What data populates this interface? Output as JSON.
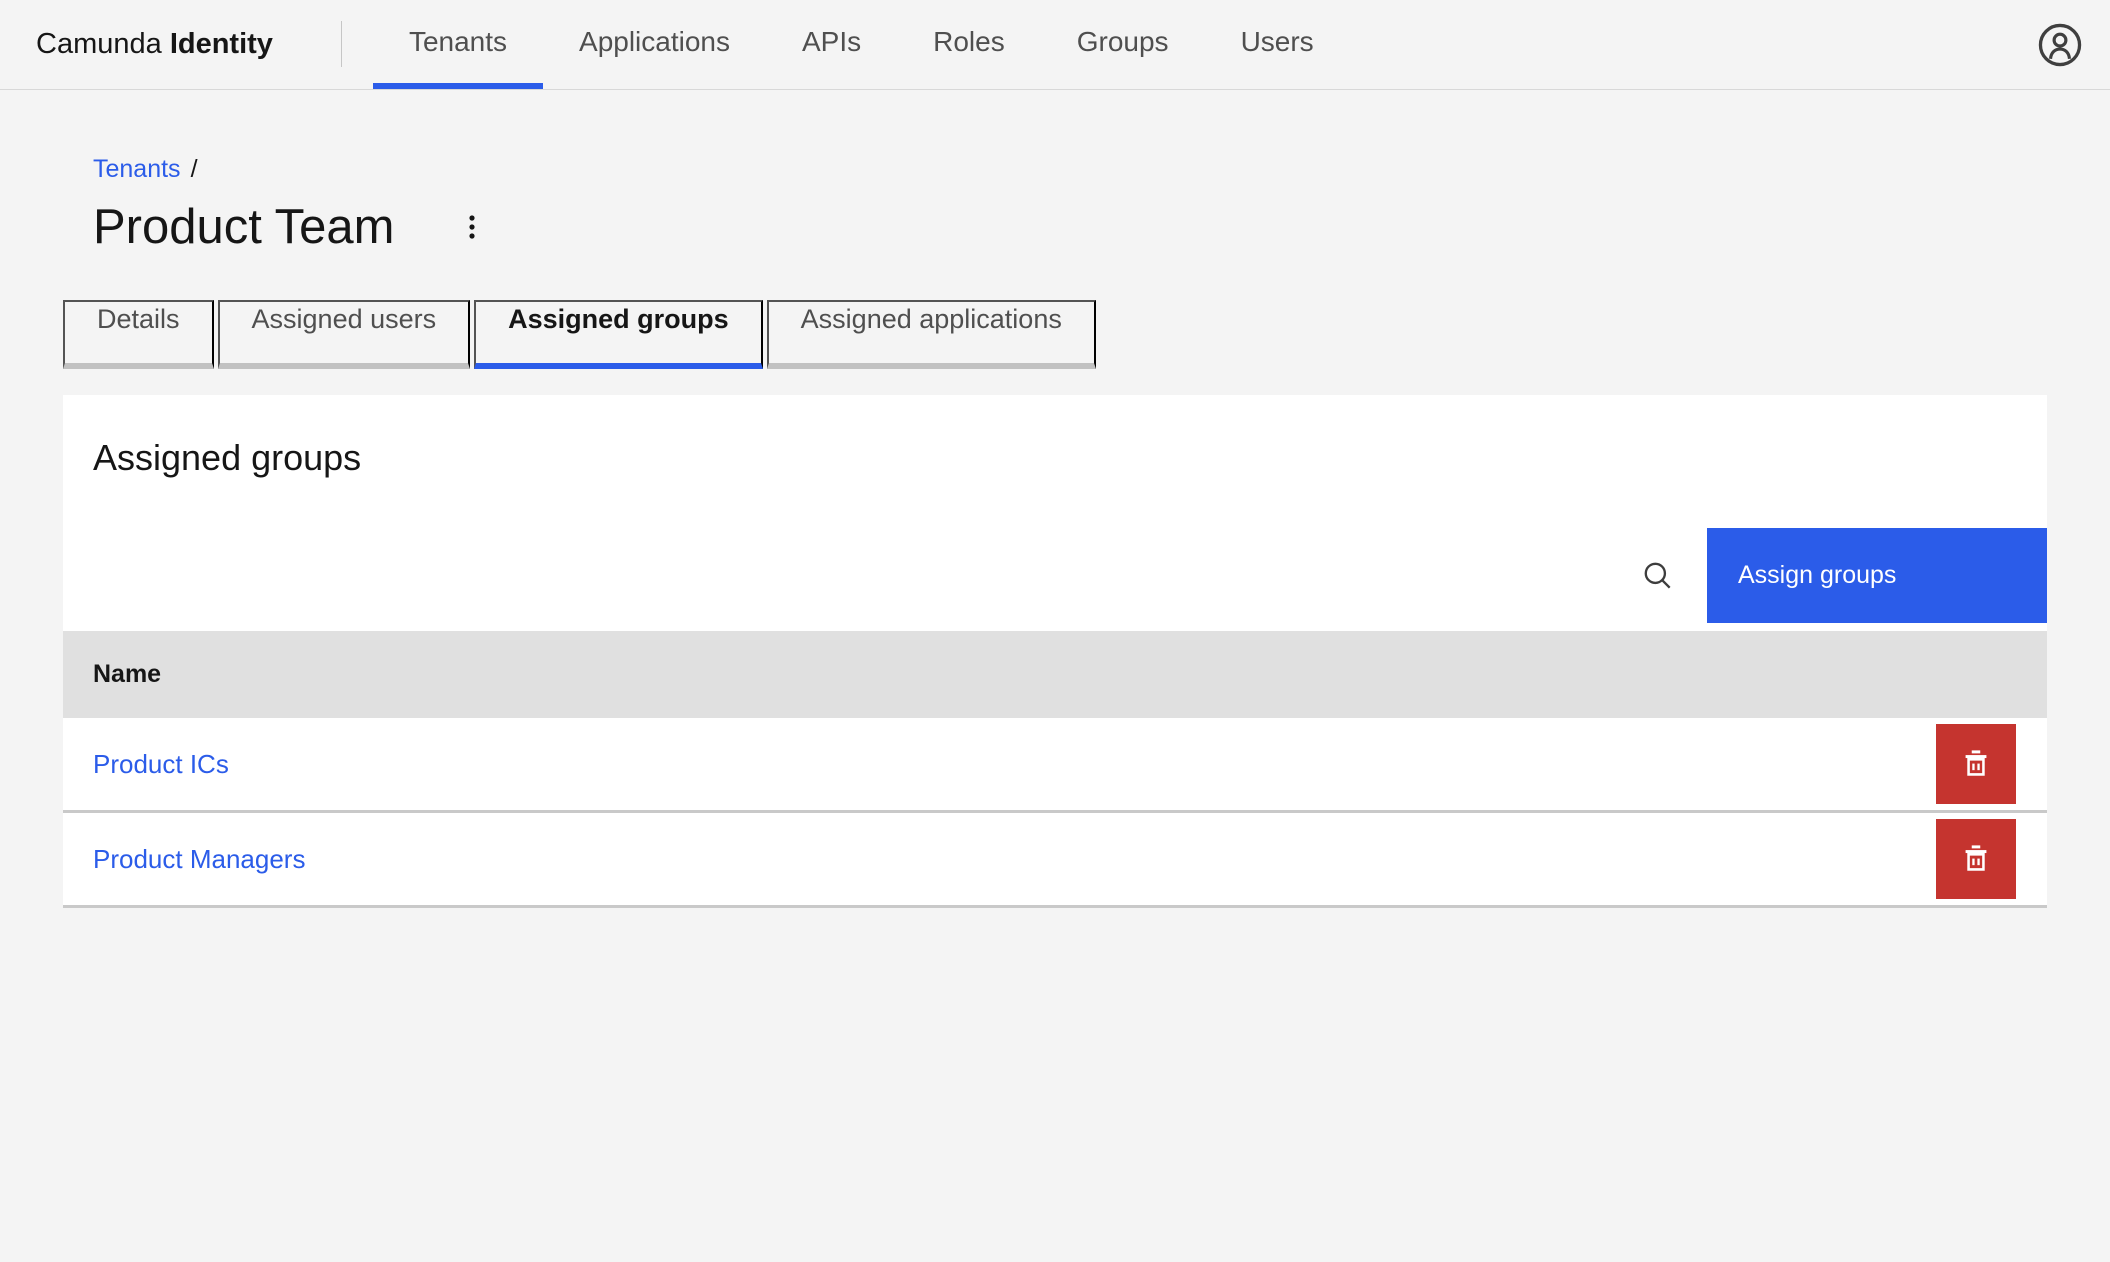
{
  "app": {
    "brand": "Camunda",
    "product": "Identity"
  },
  "header": {
    "nav": [
      {
        "label": "Tenants",
        "active": true
      },
      {
        "label": "Applications",
        "active": false
      },
      {
        "label": "APIs",
        "active": false
      },
      {
        "label": "Roles",
        "active": false
      },
      {
        "label": "Groups",
        "active": false
      },
      {
        "label": "Users",
        "active": false
      }
    ],
    "account_icon": "user-avatar"
  },
  "breadcrumb": {
    "link": "Tenants",
    "separator": "/"
  },
  "page": {
    "title": "Product Team",
    "overflow_icon": "vertical-ellipsis"
  },
  "tabs": [
    {
      "label": "Details",
      "active": false
    },
    {
      "label": "Assigned users",
      "active": false
    },
    {
      "label": "Assigned groups",
      "active": true
    },
    {
      "label": "Assigned applications",
      "active": false
    }
  ],
  "panel": {
    "heading": "Assigned groups",
    "toolbar": {
      "search_icon": "search",
      "assign_button_label": "Assign groups"
    },
    "table": {
      "columns": [
        "Name"
      ],
      "rows": [
        {
          "name": "Product ICs"
        },
        {
          "name": "Product Managers"
        }
      ],
      "row_action_icon": "trash-can"
    }
  },
  "colors": {
    "accent_blue": "#2b5ce9",
    "danger_red": "#c5342f",
    "page_background": "#f4f4f4",
    "table_header_background": "#e0e0e0",
    "link_blue": "#2b5ce9"
  }
}
